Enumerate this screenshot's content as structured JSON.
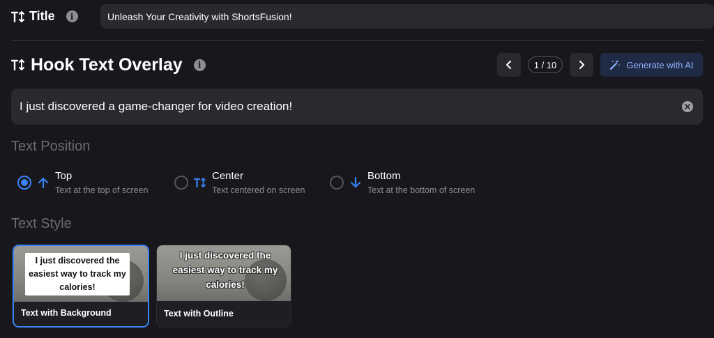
{
  "title_field": {
    "label": "Title",
    "value": "Unleash Your Creativity with ShortsFusion!"
  },
  "hook": {
    "heading": "Hook Text Overlay",
    "pager": "1 / 10",
    "generate_label": "Generate with AI",
    "text": "I just discovered a game-changer for video creation!"
  },
  "text_position": {
    "heading": "Text Position",
    "selected": "top",
    "options": [
      {
        "label": "Top",
        "desc": "Text at the top of screen",
        "icon": "arrow-up-icon"
      },
      {
        "label": "Center",
        "desc": "Text centered on screen",
        "icon": "vertical-text-icon"
      },
      {
        "label": "Bottom",
        "desc": "Text at the bottom of screen",
        "icon": "arrow-down-icon"
      }
    ]
  },
  "text_style": {
    "heading": "Text Style",
    "selected": "background",
    "cards": [
      {
        "preview": "I just discovered the easiest way to track my calories!",
        "caption": "Text with Background"
      },
      {
        "preview": "I just discovered the easiest way to track my calories!",
        "caption": "Text with Outline"
      }
    ]
  },
  "colors": {
    "background": "#18171c",
    "field": "#2a292e",
    "accent": "#3b82f6",
    "ai_button_bg": "#1f2a44",
    "ai_button_text": "#8fb4ff",
    "muted_text": "#8e8d95"
  }
}
